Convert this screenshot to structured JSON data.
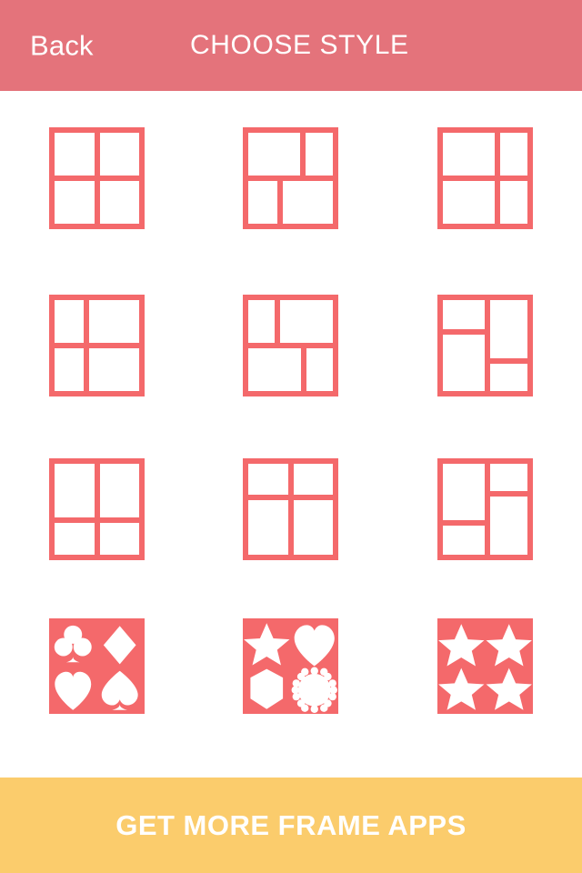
{
  "header": {
    "back_label": "Back",
    "title": "CHOOSE STYLE",
    "background_color": "#e4737b",
    "text_color": "#ffffff"
  },
  "theme": {
    "frame_stroke_color": "#f4696b",
    "page_background": "#ffffff",
    "banner_color": "#fbcc6c",
    "shape_fill_color": "#ffffff"
  },
  "styles": {
    "columns": 3,
    "rows": 4,
    "items": [
      {
        "id": 1,
        "name": "grid-2x2-even",
        "kind": "lines",
        "description": "2 by 2 equal grid"
      },
      {
        "id": 2,
        "name": "top-wide-left-bottom-wide-right",
        "kind": "lines",
        "description": "top split 62/38, bottom split 38/62"
      },
      {
        "id": 3,
        "name": "grid-2x2-wide-left",
        "kind": "lines",
        "description": "vertical split 62/38, even horizontal"
      },
      {
        "id": 4,
        "name": "grid-2x2-wide-right",
        "kind": "lines",
        "description": "vertical split 38/62, even horizontal"
      },
      {
        "id": 5,
        "name": "top-narrow-left-bottom-wide-left",
        "kind": "lines",
        "description": "top split 35/65, bottom split 63/37"
      },
      {
        "id": 6,
        "name": "left-short-top-right-tall-top",
        "kind": "lines",
        "description": "columns 52/48, left split 38, right split 62"
      },
      {
        "id": 7,
        "name": "grid-2x2-tall-top",
        "kind": "lines",
        "description": "horizontal split 62/38, even vertical"
      },
      {
        "id": 8,
        "name": "grid-2x2-tall-bottom",
        "kind": "lines",
        "description": "horizontal split 38/62, even vertical"
      },
      {
        "id": 9,
        "name": "left-tall-top-right-short-top",
        "kind": "lines",
        "description": "columns 52/48, left split 63, right split 35"
      },
      {
        "id": 10,
        "name": "shapes-card-suits",
        "kind": "shapes",
        "shapes": [
          "club",
          "diamond",
          "heart",
          "spade"
        ]
      },
      {
        "id": 11,
        "name": "shapes-mixed",
        "kind": "shapes",
        "shapes": [
          "star",
          "heart",
          "hexagon",
          "burst"
        ]
      },
      {
        "id": 12,
        "name": "shapes-four-stars",
        "kind": "shapes",
        "shapes": [
          "star",
          "star",
          "star",
          "star"
        ]
      }
    ]
  },
  "banner": {
    "label": "GET MORE FRAME APPS"
  }
}
